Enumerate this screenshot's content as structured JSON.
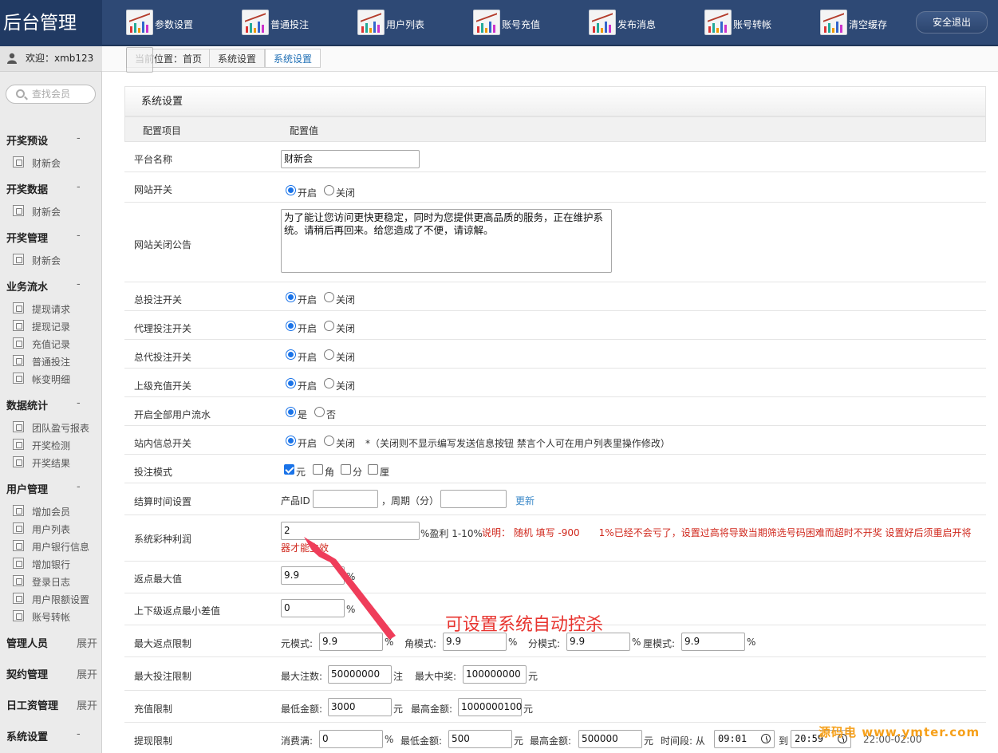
{
  "app": {
    "logo": "后台管理",
    "logout": "安全退出"
  },
  "topnav": [
    {
      "label": "参数设置"
    },
    {
      "label": "普通投注"
    },
    {
      "label": "用户列表"
    },
    {
      "label": "账号充值"
    },
    {
      "label": "发布消息"
    },
    {
      "label": "账号转帐"
    },
    {
      "label": "清空缓存"
    }
  ],
  "sidebar": {
    "welcome": "欢迎：xmb123",
    "search_placeholder": "查找会员",
    "groups": [
      {
        "title": "开奖预设",
        "toggle": "-",
        "items": [
          "财新会"
        ]
      },
      {
        "title": "开奖数据",
        "toggle": "-",
        "items": [
          "财新会"
        ]
      },
      {
        "title": "开奖管理",
        "toggle": "-",
        "items": [
          "财新会"
        ]
      },
      {
        "title": "业务流水",
        "toggle": "-",
        "items": [
          "提现请求",
          "提现记录",
          "充值记录",
          "普通投注",
          "帐变明细"
        ]
      },
      {
        "title": "数据统计",
        "toggle": "-",
        "items": [
          "团队盈亏报表",
          "开奖检测",
          "开奖结果"
        ]
      },
      {
        "title": "用户管理",
        "toggle": "-",
        "items": [
          "增加会员",
          "用户列表",
          "用户银行信息",
          "增加银行",
          "登录日志",
          "用户限额设置",
          "账号转帐"
        ]
      },
      {
        "title": "管理人员",
        "toggle": "展开",
        "items": []
      },
      {
        "title": "契约管理",
        "toggle": "展开",
        "items": []
      },
      {
        "title": "日工资管理",
        "toggle": "展开",
        "items": []
      },
      {
        "title": "系统设置",
        "toggle": "-",
        "items": []
      }
    ]
  },
  "breadcrumb": {
    "prefix": "当前位置：首页",
    "items": [
      "系统设置",
      "系统设置"
    ]
  },
  "section": {
    "title": "系统设置",
    "col_key": "配置项目",
    "col_val": "配置值"
  },
  "form": {
    "platform_name": {
      "label": "平台名称",
      "value": "财新会"
    },
    "site_switch": {
      "label": "网站开关",
      "on": "开启",
      "off": "关闭",
      "selected": "on"
    },
    "close_notice": {
      "label": "网站关闭公告",
      "value": "为了能让您访问更快更稳定，同时为您提供更高品质的服务，正在维护系统。请稍后再回来。给您造成了不便，请谅解。"
    },
    "bet_switch": {
      "label": "总投注开关",
      "on": "开启",
      "off": "关闭",
      "selected": "on"
    },
    "agent_bet_switch": {
      "label": "代理投注开关",
      "on": "开启",
      "off": "关闭",
      "selected": "on"
    },
    "general_agent_bet_switch": {
      "label": "总代投注开关",
      "on": "开启",
      "off": "关闭",
      "selected": "on"
    },
    "upper_recharge_switch": {
      "label": "上级充值开关",
      "on": "开启",
      "off": "关闭",
      "selected": "on"
    },
    "all_user_flow": {
      "label": "开启全部用户流水",
      "on": "是",
      "off": "否",
      "selected": "on"
    },
    "site_msg_switch": {
      "label": "站内信总开关",
      "on": "开启",
      "off": "关闭",
      "selected": "on",
      "note": "*（关闭则不显示编写发送信息按钮 禁言个人可在用户列表里操作修改）"
    },
    "bet_mode": {
      "label": "投注模式",
      "options": [
        {
          "label": "元",
          "checked": true
        },
        {
          "label": "角",
          "checked": false
        },
        {
          "label": "分",
          "checked": false
        },
        {
          "label": "厘",
          "checked": false
        }
      ]
    },
    "settle_time": {
      "label": "结算时间设置",
      "product_label": "产品ID",
      "product_value": "",
      "period_label": "，周期（分）",
      "period_value": "",
      "update": "更新"
    },
    "profit": {
      "label": "系统彩种利润",
      "value": "2",
      "suffix": "%盈利 1-10%",
      "note": "说明： 随机 填写 -900　　1%已经不会亏了，设置过高将导致当期筛选号码困难而超时不开奖 设置好后须重启开将器才能生效"
    },
    "rebate_max": {
      "label": "返点最大值",
      "value": "9.9",
      "unit": "%"
    },
    "rebate_diff": {
      "label": "上下级返点最小差值",
      "value": "0",
      "unit": "%"
    },
    "rebate_limit": {
      "label": "最大返点限制",
      "items": [
        {
          "label": "元模式:",
          "value": "9.9",
          "unit": "%"
        },
        {
          "label": "角模式:",
          "value": "9.9",
          "unit": "%"
        },
        {
          "label": "分模式:",
          "value": "9.9",
          "unit": "%"
        },
        {
          "label": "厘模式:",
          "value": "9.9",
          "unit": "%"
        }
      ]
    },
    "bet_limit": {
      "label": "最大投注限制",
      "items": [
        {
          "label": "最大注数:",
          "value": "50000000",
          "unit": "注"
        },
        {
          "label": "最大中奖:",
          "value": "100000000",
          "unit": "元"
        }
      ]
    },
    "recharge_limit": {
      "label": "充值限制",
      "items": [
        {
          "label": "最低金额:",
          "value": "3000",
          "unit": "元"
        },
        {
          "label": "最高金额:",
          "value": "1000000100",
          "unit": "元"
        }
      ]
    },
    "withdraw_limit": {
      "label": "提现限制",
      "consume_label": "消费满:",
      "consume_value": "0",
      "consume_unit": "%",
      "min_label": "最低金额:",
      "min_value": "500",
      "min_unit": "元",
      "max_label": "最高金额:",
      "max_value": "500000",
      "max_unit": "元",
      "time_label": "时间段: 从",
      "time_from": "09:01",
      "time_to_label": "到",
      "time_to": "20:59",
      "time_range": "22:00-02:00"
    }
  },
  "annotation": "可设置系统自动控杀",
  "watermark": "源码电 www.ymter.com",
  "colors": {
    "topbar": "#2e4975",
    "annotation": "#e8342f",
    "note_red": "#d0281d",
    "link": "#3d8ac9",
    "watermark": "#f6a01a"
  }
}
